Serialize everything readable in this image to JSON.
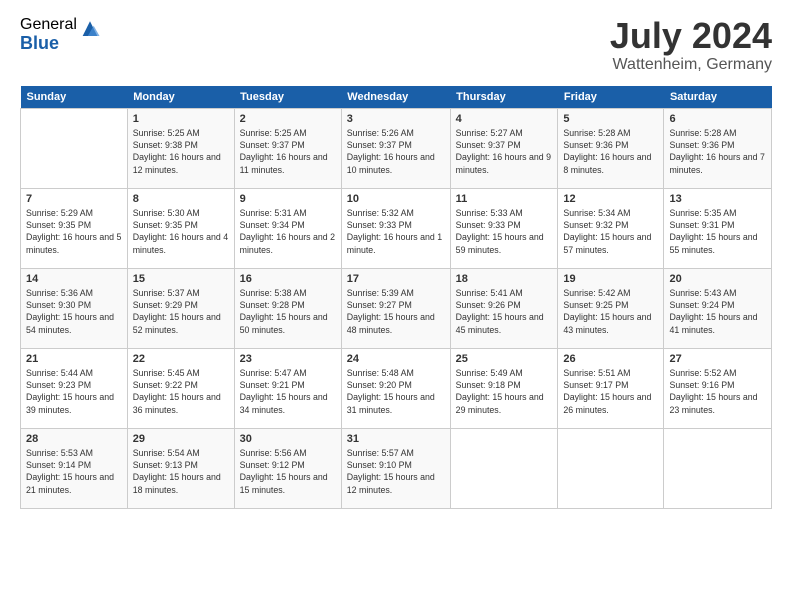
{
  "logo": {
    "general": "General",
    "blue": "Blue"
  },
  "header": {
    "month": "July 2024",
    "location": "Wattenheim, Germany"
  },
  "days_of_week": [
    "Sunday",
    "Monday",
    "Tuesday",
    "Wednesday",
    "Thursday",
    "Friday",
    "Saturday"
  ],
  "weeks": [
    [
      {
        "day": "",
        "sunrise": "",
        "sunset": "",
        "daylight": ""
      },
      {
        "day": "1",
        "sunrise": "Sunrise: 5:25 AM",
        "sunset": "Sunset: 9:38 PM",
        "daylight": "Daylight: 16 hours and 12 minutes."
      },
      {
        "day": "2",
        "sunrise": "Sunrise: 5:25 AM",
        "sunset": "Sunset: 9:37 PM",
        "daylight": "Daylight: 16 hours and 11 minutes."
      },
      {
        "day": "3",
        "sunrise": "Sunrise: 5:26 AM",
        "sunset": "Sunset: 9:37 PM",
        "daylight": "Daylight: 16 hours and 10 minutes."
      },
      {
        "day": "4",
        "sunrise": "Sunrise: 5:27 AM",
        "sunset": "Sunset: 9:37 PM",
        "daylight": "Daylight: 16 hours and 9 minutes."
      },
      {
        "day": "5",
        "sunrise": "Sunrise: 5:28 AM",
        "sunset": "Sunset: 9:36 PM",
        "daylight": "Daylight: 16 hours and 8 minutes."
      },
      {
        "day": "6",
        "sunrise": "Sunrise: 5:28 AM",
        "sunset": "Sunset: 9:36 PM",
        "daylight": "Daylight: 16 hours and 7 minutes."
      }
    ],
    [
      {
        "day": "7",
        "sunrise": "Sunrise: 5:29 AM",
        "sunset": "Sunset: 9:35 PM",
        "daylight": "Daylight: 16 hours and 5 minutes."
      },
      {
        "day": "8",
        "sunrise": "Sunrise: 5:30 AM",
        "sunset": "Sunset: 9:35 PM",
        "daylight": "Daylight: 16 hours and 4 minutes."
      },
      {
        "day": "9",
        "sunrise": "Sunrise: 5:31 AM",
        "sunset": "Sunset: 9:34 PM",
        "daylight": "Daylight: 16 hours and 2 minutes."
      },
      {
        "day": "10",
        "sunrise": "Sunrise: 5:32 AM",
        "sunset": "Sunset: 9:33 PM",
        "daylight": "Daylight: 16 hours and 1 minute."
      },
      {
        "day": "11",
        "sunrise": "Sunrise: 5:33 AM",
        "sunset": "Sunset: 9:33 PM",
        "daylight": "Daylight: 15 hours and 59 minutes."
      },
      {
        "day": "12",
        "sunrise": "Sunrise: 5:34 AM",
        "sunset": "Sunset: 9:32 PM",
        "daylight": "Daylight: 15 hours and 57 minutes."
      },
      {
        "day": "13",
        "sunrise": "Sunrise: 5:35 AM",
        "sunset": "Sunset: 9:31 PM",
        "daylight": "Daylight: 15 hours and 55 minutes."
      }
    ],
    [
      {
        "day": "14",
        "sunrise": "Sunrise: 5:36 AM",
        "sunset": "Sunset: 9:30 PM",
        "daylight": "Daylight: 15 hours and 54 minutes."
      },
      {
        "day": "15",
        "sunrise": "Sunrise: 5:37 AM",
        "sunset": "Sunset: 9:29 PM",
        "daylight": "Daylight: 15 hours and 52 minutes."
      },
      {
        "day": "16",
        "sunrise": "Sunrise: 5:38 AM",
        "sunset": "Sunset: 9:28 PM",
        "daylight": "Daylight: 15 hours and 50 minutes."
      },
      {
        "day": "17",
        "sunrise": "Sunrise: 5:39 AM",
        "sunset": "Sunset: 9:27 PM",
        "daylight": "Daylight: 15 hours and 48 minutes."
      },
      {
        "day": "18",
        "sunrise": "Sunrise: 5:41 AM",
        "sunset": "Sunset: 9:26 PM",
        "daylight": "Daylight: 15 hours and 45 minutes."
      },
      {
        "day": "19",
        "sunrise": "Sunrise: 5:42 AM",
        "sunset": "Sunset: 9:25 PM",
        "daylight": "Daylight: 15 hours and 43 minutes."
      },
      {
        "day": "20",
        "sunrise": "Sunrise: 5:43 AM",
        "sunset": "Sunset: 9:24 PM",
        "daylight": "Daylight: 15 hours and 41 minutes."
      }
    ],
    [
      {
        "day": "21",
        "sunrise": "Sunrise: 5:44 AM",
        "sunset": "Sunset: 9:23 PM",
        "daylight": "Daylight: 15 hours and 39 minutes."
      },
      {
        "day": "22",
        "sunrise": "Sunrise: 5:45 AM",
        "sunset": "Sunset: 9:22 PM",
        "daylight": "Daylight: 15 hours and 36 minutes."
      },
      {
        "day": "23",
        "sunrise": "Sunrise: 5:47 AM",
        "sunset": "Sunset: 9:21 PM",
        "daylight": "Daylight: 15 hours and 34 minutes."
      },
      {
        "day": "24",
        "sunrise": "Sunrise: 5:48 AM",
        "sunset": "Sunset: 9:20 PM",
        "daylight": "Daylight: 15 hours and 31 minutes."
      },
      {
        "day": "25",
        "sunrise": "Sunrise: 5:49 AM",
        "sunset": "Sunset: 9:18 PM",
        "daylight": "Daylight: 15 hours and 29 minutes."
      },
      {
        "day": "26",
        "sunrise": "Sunrise: 5:51 AM",
        "sunset": "Sunset: 9:17 PM",
        "daylight": "Daylight: 15 hours and 26 minutes."
      },
      {
        "day": "27",
        "sunrise": "Sunrise: 5:52 AM",
        "sunset": "Sunset: 9:16 PM",
        "daylight": "Daylight: 15 hours and 23 minutes."
      }
    ],
    [
      {
        "day": "28",
        "sunrise": "Sunrise: 5:53 AM",
        "sunset": "Sunset: 9:14 PM",
        "daylight": "Daylight: 15 hours and 21 minutes."
      },
      {
        "day": "29",
        "sunrise": "Sunrise: 5:54 AM",
        "sunset": "Sunset: 9:13 PM",
        "daylight": "Daylight: 15 hours and 18 minutes."
      },
      {
        "day": "30",
        "sunrise": "Sunrise: 5:56 AM",
        "sunset": "Sunset: 9:12 PM",
        "daylight": "Daylight: 15 hours and 15 minutes."
      },
      {
        "day": "31",
        "sunrise": "Sunrise: 5:57 AM",
        "sunset": "Sunset: 9:10 PM",
        "daylight": "Daylight: 15 hours and 12 minutes."
      },
      {
        "day": "",
        "sunrise": "",
        "sunset": "",
        "daylight": ""
      },
      {
        "day": "",
        "sunrise": "",
        "sunset": "",
        "daylight": ""
      },
      {
        "day": "",
        "sunrise": "",
        "sunset": "",
        "daylight": ""
      }
    ]
  ]
}
